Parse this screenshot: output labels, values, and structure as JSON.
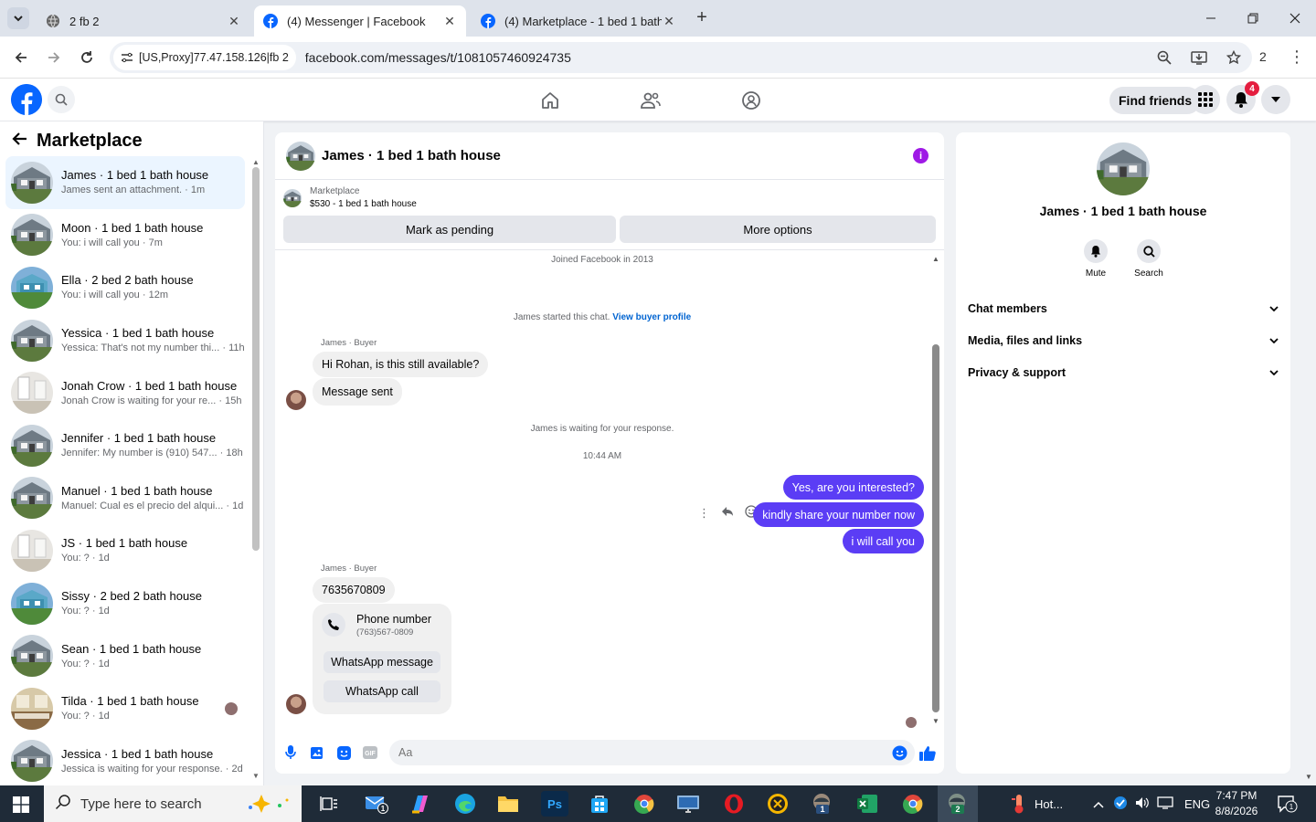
{
  "browser": {
    "tabs": [
      {
        "label": "2 fb 2",
        "active": false
      },
      {
        "label": "(4) Messenger | Facebook",
        "active": true
      },
      {
        "label": "(4) Marketplace - 1 bed 1 bath",
        "active": false
      }
    ],
    "proxy_chip": "[US,Proxy]77.47.158.126|fb 2",
    "url": "facebook.com/messages/t/1081057460924735",
    "profile_count": "2"
  },
  "header": {
    "find_friends_label": "Find friends",
    "notification_count": "4"
  },
  "sidebar": {
    "title": "Marketplace",
    "conversations": [
      {
        "name": "James · 1 bed 1 bath house",
        "preview": "James sent an attachment. · 1m",
        "avatar": "house-gray"
      },
      {
        "name": "Moon · 1 bed 1 bath house",
        "preview": "You: i will call you · 7m",
        "avatar": "house-gray"
      },
      {
        "name": "Ella · 2 bed 2 bath house",
        "preview": "You: i will call you · 12m",
        "avatar": "house-blue"
      },
      {
        "name": "Yessica · 1 bed 1 bath house",
        "preview": "Yessica: That's not my number thi... · 11h",
        "avatar": "house-gray"
      },
      {
        "name": "Jonah Crow · 1 bed 1 bath house",
        "preview": "Jonah Crow is waiting for your re... · 15h",
        "avatar": "interior"
      },
      {
        "name": "Jennifer · 1 bed 1 bath house",
        "preview": "Jennifer: My number is (910) 547... · 18h",
        "avatar": "house-gray"
      },
      {
        "name": "Manuel · 1 bed 1 bath house",
        "preview": "Manuel: Cual es el precio del alqui... · 1d",
        "avatar": "house-gray"
      },
      {
        "name": "JS · 1 bed 1 bath house",
        "preview": "You: ? · 1d",
        "avatar": "interior"
      },
      {
        "name": "Sissy · 2 bed 2 bath house",
        "preview": "You: ? · 1d",
        "avatar": "house-blue"
      },
      {
        "name": "Sean · 1 bed 1 bath house",
        "preview": "You: ? · 1d",
        "avatar": "house-gray"
      },
      {
        "name": "Tilda · 1 bed 1 bath house",
        "preview": "You: ? · 1d",
        "avatar": "kitchen"
      },
      {
        "name": "Jessica · 1 bed 1 bath house",
        "preview": "Jessica is waiting for your response. · 2d",
        "avatar": "house-gray"
      }
    ]
  },
  "chat": {
    "title": "James · 1 bed 1 bath house",
    "marketplace_label": "Marketplace",
    "listing_price": "$530 - 1 bed 1 bath house",
    "mark_pending_label": "Mark as pending",
    "more_options_label": "More options",
    "joined_text": "Joined Facebook in 2013",
    "started_text": "James started this chat.",
    "view_profile_link": "View buyer profile",
    "sender_label": "James · Buyer",
    "incoming_1": "Hi Rohan, is this still available?",
    "incoming_2": "Message sent",
    "waiting_text": "James is waiting for your response.",
    "timestamp": "10:44 AM",
    "outgoing_1": "Yes, are you interested?",
    "outgoing_2": "kindly share your number now",
    "outgoing_3": "i will call you",
    "incoming_3": "7635670809",
    "phone_card_title": "Phone number",
    "phone_card_number": "(763)567-0809",
    "whatsapp_message_label": "WhatsApp message",
    "whatsapp_call_label": "WhatsApp call",
    "composer_placeholder": "Aa"
  },
  "info_panel": {
    "name": "James · 1 bed 1 bath house",
    "mute_label": "Mute",
    "search_label": "Search",
    "sections": [
      "Chat members",
      "Media, files and links",
      "Privacy & support"
    ]
  },
  "taskbar": {
    "search_placeholder": "Type here to search",
    "weather": "Hot...",
    "language": "ENG",
    "time": "7:47 PM",
    "date": "8/8/2026",
    "notification_count": "1",
    "badge_1": "1",
    "badge_2": "2"
  }
}
